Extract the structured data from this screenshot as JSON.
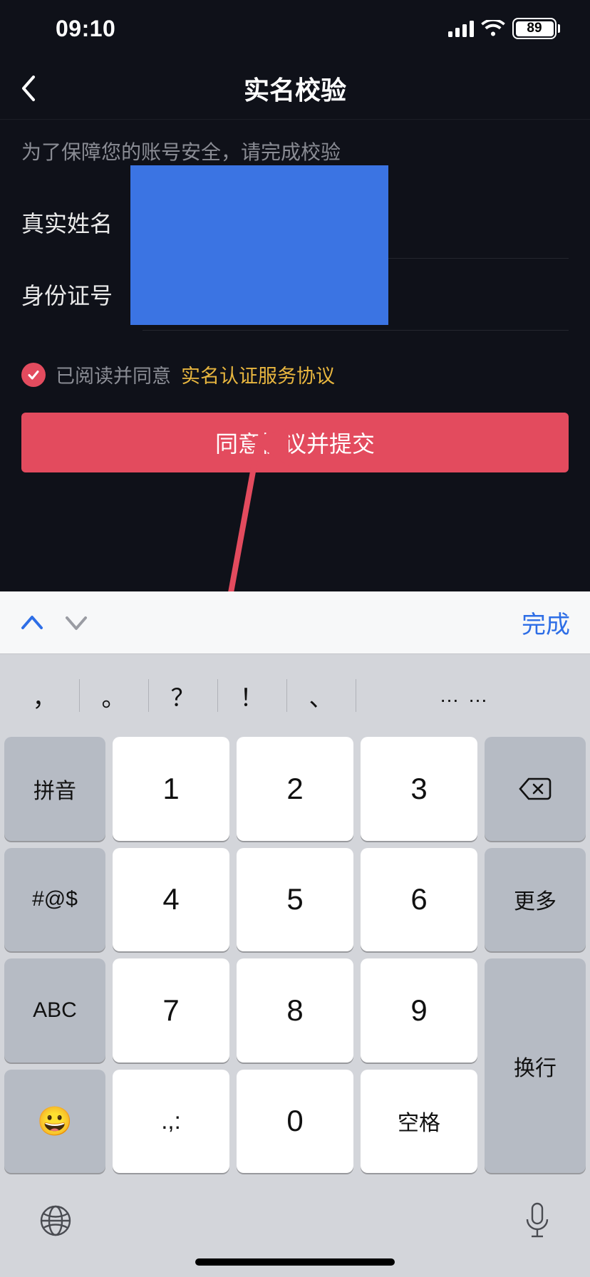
{
  "status": {
    "time": "09:10",
    "battery": "89"
  },
  "nav": {
    "title": "实名校验"
  },
  "form": {
    "hint": "为了保障您的账号安全，请完成校验",
    "name_label": "真实姓名",
    "id_label": "身份证号",
    "agree_prefix": "已阅读并同意",
    "agree_link": "实名认证服务协议",
    "submit": "同意协议并提交"
  },
  "accessory": {
    "done": "完成"
  },
  "keyboard": {
    "symbols": [
      "，",
      "。",
      "？",
      "！",
      "、",
      "……"
    ],
    "side_left": [
      "拼音",
      "#@$",
      "ABC",
      "😀"
    ],
    "numbers": [
      "1",
      "2",
      "3",
      "4",
      "5",
      "6",
      "7",
      "8",
      "9",
      ".,:",
      "0",
      "空格"
    ],
    "side_right_backspace": "⌫",
    "side_right_more": "更多",
    "side_right_enter": "换行"
  }
}
